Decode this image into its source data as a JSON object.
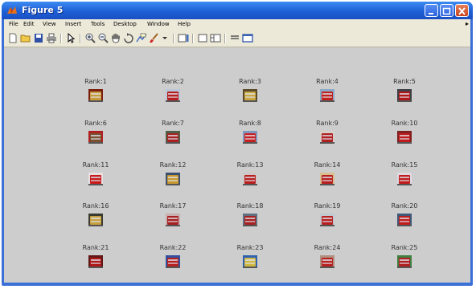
{
  "window": {
    "title": "Figure 5"
  },
  "menu": [
    "File",
    "Edit",
    "View",
    "Insert",
    "Tools",
    "Desktop",
    "Window",
    "Help"
  ],
  "toolbar": [
    "new-figure-icon",
    "open-folder-icon",
    "save-icon",
    "print-icon",
    "pointer-icon",
    "zoom-in-icon",
    "zoom-out-icon",
    "pan-hand-icon",
    "rotate-3d-icon",
    "data-cursor-icon",
    "brush-icon",
    "colorbar-icon",
    "legend-icon",
    "hide-plot-tools-icon",
    "show-plot-tools-icon",
    "dock-icon",
    "undock-icon"
  ],
  "results": [
    {
      "label": "Rank:1",
      "colors": [
        "#c89a3a",
        "#7a1f10"
      ]
    },
    {
      "label": "Rank:2",
      "colors": [
        "#b81c1c",
        "#b8c8d8"
      ]
    },
    {
      "label": "Rank:3",
      "colors": [
        "#c9a640",
        "#5a4a2a"
      ]
    },
    {
      "label": "Rank:4",
      "colors": [
        "#c0201c",
        "#8aa8c8"
      ]
    },
    {
      "label": "Rank:5",
      "colors": [
        "#b01818",
        "#404048"
      ]
    },
    {
      "label": "Rank:6",
      "colors": [
        "#7a5030",
        "#b02020"
      ]
    },
    {
      "label": "Rank:7",
      "colors": [
        "#a82020",
        "#506048"
      ]
    },
    {
      "label": "Rank:8",
      "colors": [
        "#c82020",
        "#8098c0"
      ]
    },
    {
      "label": "Rank:9",
      "colors": [
        "#b02020",
        "#d8d0c8"
      ]
    },
    {
      "label": "Rank:10",
      "colors": [
        "#c01c1c",
        "#802020"
      ]
    },
    {
      "label": "Rank:11",
      "colors": [
        "#c81c1c",
        "#e8e0e0"
      ]
    },
    {
      "label": "Rank:12",
      "colors": [
        "#c89830",
        "#3a5070"
      ]
    },
    {
      "label": "Rank:13",
      "colors": [
        "#b82020",
        "#d0c8c8"
      ]
    },
    {
      "label": "Rank:14",
      "colors": [
        "#b82020",
        "#d8c090"
      ]
    },
    {
      "label": "Rank:15",
      "colors": [
        "#c01c1c",
        "#e0d8e0"
      ]
    },
    {
      "label": "Rank:16",
      "colors": [
        "#c8a040",
        "#3a3a30"
      ]
    },
    {
      "label": "Rank:17",
      "colors": [
        "#a82020",
        "#c8b0b0"
      ]
    },
    {
      "label": "Rank:18",
      "colors": [
        "#a82020",
        "#607080"
      ]
    },
    {
      "label": "Rank:19",
      "colors": [
        "#b82020",
        "#c0c8d0"
      ]
    },
    {
      "label": "Rank:20",
      "colors": [
        "#c01c1c",
        "#405878"
      ]
    },
    {
      "label": "Rank:21",
      "colors": [
        "#b01818",
        "#601818"
      ]
    },
    {
      "label": "Rank:22",
      "colors": [
        "#b82020",
        "#3050a0"
      ]
    },
    {
      "label": "Rank:23",
      "colors": [
        "#d0b840",
        "#3060b0"
      ]
    },
    {
      "label": "Rank:24",
      "colors": [
        "#b82020",
        "#b09080"
      ]
    },
    {
      "label": "Rank:25",
      "colors": [
        "#b02020",
        "#408040"
      ]
    }
  ]
}
